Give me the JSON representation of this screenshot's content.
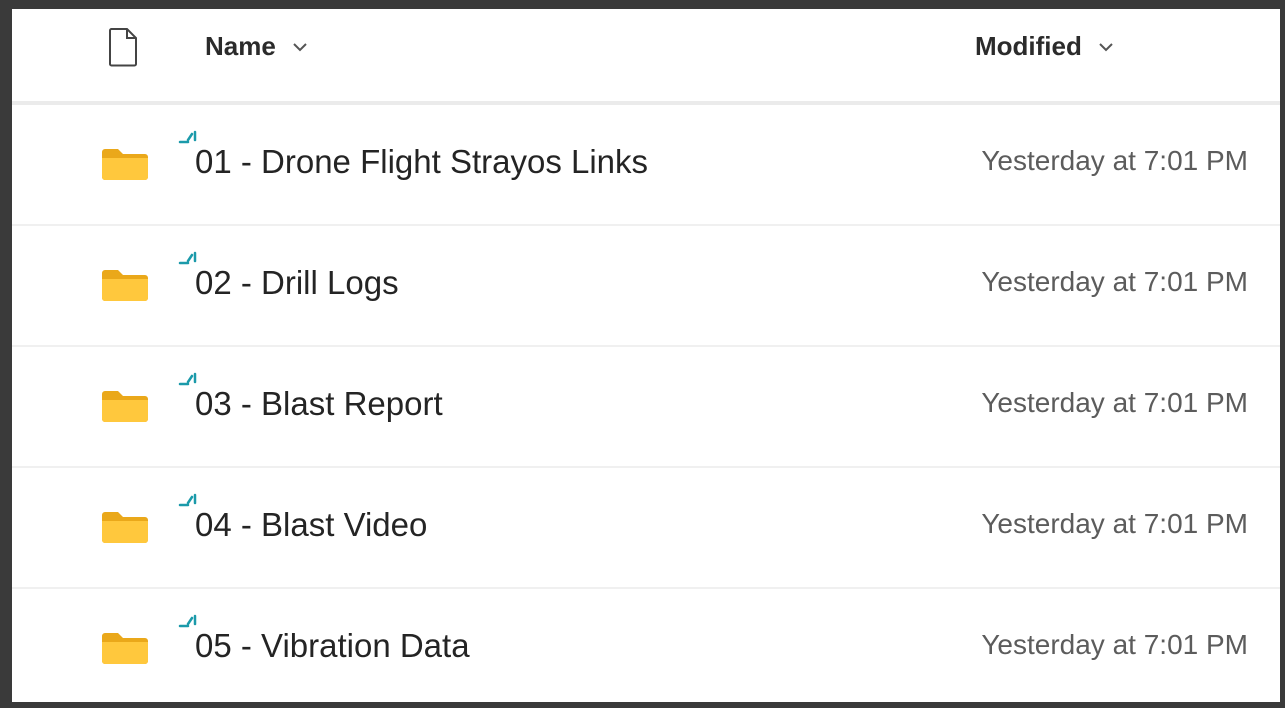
{
  "header": {
    "file_type_icon": "file-icon",
    "name_label": "Name",
    "modified_label": "Modified",
    "sort_icon": "chevron-down-icon"
  },
  "colors": {
    "folder": "#ffc83d",
    "folder_back": "#eaa81a",
    "sync_accent": "#1b9aaa",
    "text_primary": "#242424",
    "text_secondary": "#5c5c5c"
  },
  "rows": [
    {
      "icon": "folder-icon",
      "sync_icon": "shared-sync-icon",
      "name": "01 - Drone Flight Strayos Links",
      "modified": "Yesterday at 7:01 PM"
    },
    {
      "icon": "folder-icon",
      "sync_icon": "shared-sync-icon",
      "name": "02 - Drill Logs",
      "modified": "Yesterday at 7:01 PM"
    },
    {
      "icon": "folder-icon",
      "sync_icon": "shared-sync-icon",
      "name": "03 - Blast Report",
      "modified": "Yesterday at 7:01 PM"
    },
    {
      "icon": "folder-icon",
      "sync_icon": "shared-sync-icon",
      "name": "04 - Blast Video",
      "modified": "Yesterday at 7:01 PM"
    },
    {
      "icon": "folder-icon",
      "sync_icon": "shared-sync-icon",
      "name": "05 - Vibration Data",
      "modified": "Yesterday at 7:01 PM"
    }
  ]
}
